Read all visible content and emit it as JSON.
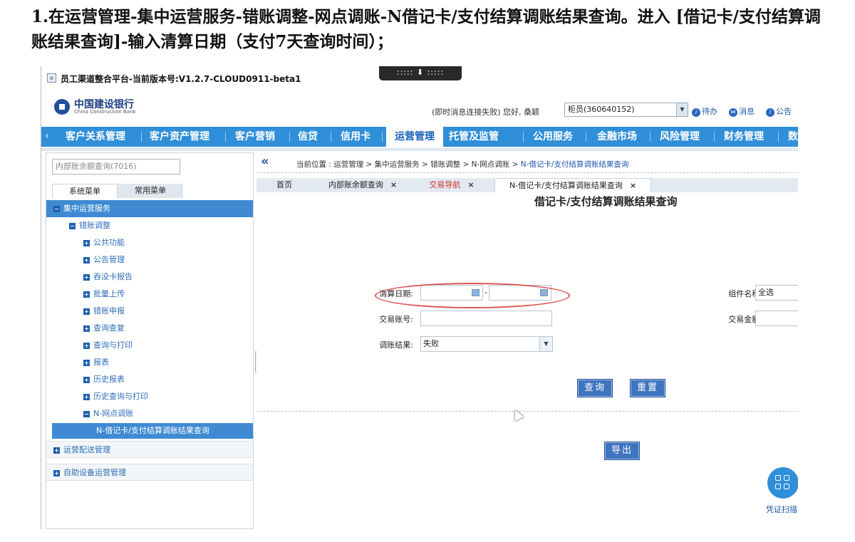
{
  "doc": {
    "heading": "1.在运营管理-集中运营服务-错账调整-网点调账-N借记卡/支付结算调账结果查询。进入 [借记卡/支付结算调账结果查询]-输入清算日期（支付7天查询时间）；"
  },
  "window": {
    "title": "员工渠道整合平台-当前版本号:V1.2.7-CLOUD0911-beta1",
    "overlay_handle": "::::: ⬇ :::::"
  },
  "header": {
    "logo_cn": "中国建设银行",
    "logo_en": "China Construction Bank",
    "status": "(即时消息连接失败) 您好, 桑颖",
    "role": "柜员(360640152)",
    "links": [
      "待办",
      "消息",
      "公告"
    ]
  },
  "nav": {
    "items": [
      "客户关系管理",
      "客户资产管理",
      "客户营销",
      "信贷",
      "信用卡",
      "运营管理",
      "托管及监管",
      "公用服务",
      "金融市场",
      "风险管理",
      "财务管理",
      "数"
    ],
    "active_index": 5
  },
  "sidebar": {
    "search_placeholder": "内部账余额查询(7016)",
    "tabs": [
      "系统菜单",
      "常用菜单"
    ],
    "tree": [
      {
        "label": "集中运营服务",
        "level": 0,
        "expanded": true
      },
      {
        "label": "错账调整",
        "level": 1,
        "expanded": true
      },
      {
        "label": "公共功能",
        "level": 2
      },
      {
        "label": "公告管理",
        "level": 2
      },
      {
        "label": "吞没卡报告",
        "level": 2
      },
      {
        "label": "批量上传",
        "level": 2
      },
      {
        "label": "错账申报",
        "level": 2
      },
      {
        "label": "查询查复",
        "level": 2
      },
      {
        "label": "查询与打印",
        "level": 2
      },
      {
        "label": "报表",
        "level": 2
      },
      {
        "label": "历史报表",
        "level": 2
      },
      {
        "label": "历史查询与打印",
        "level": 2
      },
      {
        "label": "N-网点调账",
        "level": 2,
        "expanded": true
      },
      {
        "label": "N-借记卡/支付结算调账结果查询",
        "level": 3,
        "selected": true
      },
      {
        "label": "运营配送管理",
        "level": 0
      },
      {
        "label": "自助设备运营管理",
        "level": 0
      }
    ]
  },
  "content": {
    "breadcrumb_prefix": "当前位置 : 运营管理 > 集中运营服务 > 错账调整 > N-网点调账 > ",
    "breadcrumb_current": "N-借记卡/支付结算调账结果查询",
    "tabs": [
      {
        "label": "首页",
        "closable": false
      },
      {
        "label": "内部账余额查询",
        "closable": true
      },
      {
        "label": "交易导航",
        "closable": true,
        "red": true
      },
      {
        "label": "N-借记卡/支付结算调账结果查询",
        "closable": true,
        "active": true
      }
    ],
    "form_title": "借记卡/支付结算调账结果查询",
    "fields": {
      "settle_date_label": "清算日期:",
      "settle_date_start": "",
      "settle_date_end": "",
      "component_label": "组件名称:",
      "component_value": "全选",
      "account_label": "交易账号:",
      "account_value": "",
      "amount_label": "交易金额:",
      "amount_value": "",
      "result_label": "调账结果:",
      "result_value": "失败"
    },
    "buttons": {
      "query": "查询",
      "reset": "重置",
      "export": "导出"
    },
    "float_button_label": "凭证扫描"
  },
  "colors": {
    "nav_bg": "#2f8fd8",
    "accent": "#1f56a8",
    "highlight": "#e05555"
  }
}
